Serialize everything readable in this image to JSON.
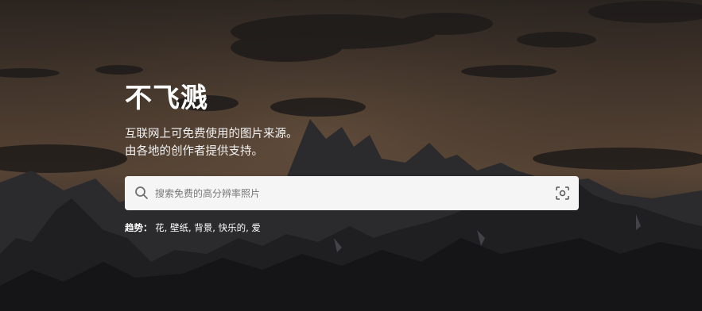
{
  "hero": {
    "title": "不飞溅",
    "subtitle_line1": "互联网上可免费使用的图片来源。",
    "subtitle_line2": "由各地的创作者提供支持。"
  },
  "search": {
    "placeholder": "搜索免费的高分辨率照片",
    "value": "",
    "search_icon": "search-icon",
    "visual_search_icon": "visual-search-icon"
  },
  "trending": {
    "label": "趋势：",
    "items": [
      "花",
      "壁纸",
      "背景",
      "快乐的",
      "爱"
    ]
  }
}
